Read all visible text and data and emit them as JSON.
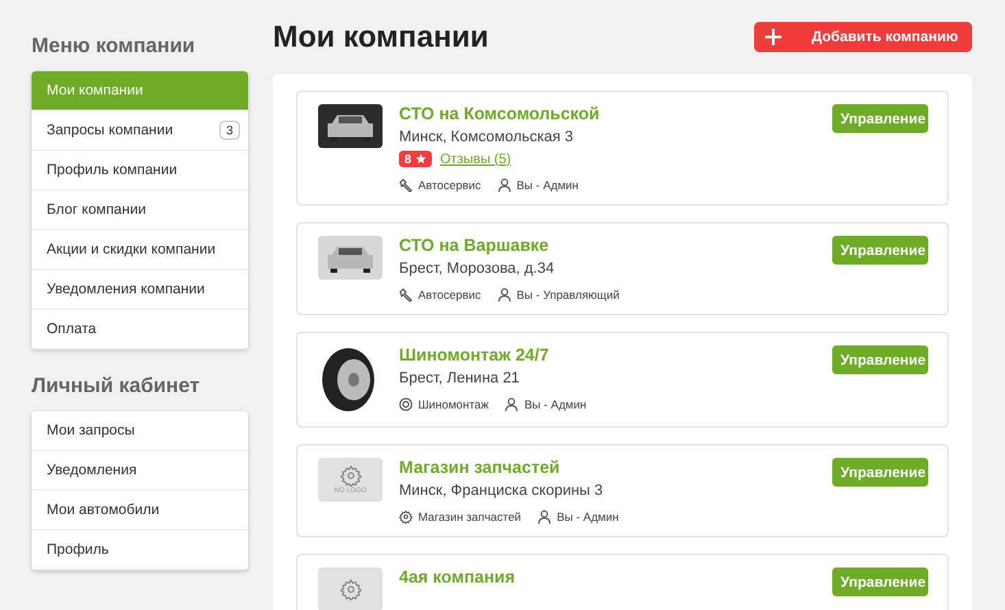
{
  "sidebar": {
    "sections": [
      {
        "title": "Меню компании",
        "items": [
          {
            "label": "Мои компании",
            "selected": true
          },
          {
            "label": "Запросы компании",
            "selected": false,
            "count": "3"
          },
          {
            "label": "Профиль компании",
            "selected": false
          },
          {
            "label": "Блог компании",
            "selected": false
          },
          {
            "label": "Акции и скидки компании",
            "selected": false
          },
          {
            "label": "Уведомления компании",
            "selected": false
          },
          {
            "label": "Оплата",
            "selected": false
          }
        ]
      },
      {
        "title": "Личный кабинет",
        "items": [
          {
            "label": "Мои запросы",
            "selected": false
          },
          {
            "label": "Уведомления",
            "selected": false
          },
          {
            "label": "Мои автомобили",
            "selected": false
          },
          {
            "label": "Профиль",
            "selected": false
          }
        ]
      }
    ]
  },
  "page_title": "Мои компании",
  "add_button": {
    "label": "Добавить компанию"
  },
  "companies": [
    {
      "name": "СТО на Комсомольской",
      "address": "Минск, Комсомольская 3",
      "logo": {
        "kind": "car"
      },
      "rating": "8",
      "reviews": "Отзывы (5)",
      "category": {
        "kind": "wrench",
        "label": "Автосервис"
      },
      "role": "Вы - Админ",
      "button": "Управление"
    },
    {
      "name": "СТО на Варшавке",
      "address": "Брест, Морозова, д.34",
      "logo": {
        "kind": "car"
      },
      "category": {
        "kind": "wrench",
        "label": "Автосервис"
      },
      "role": "Вы - Управляющий",
      "button": "Управление"
    },
    {
      "name": "Шиномонтаж 24/7",
      "address": "Брест, Ленина 21",
      "logo": {
        "kind": "tire"
      },
      "category": {
        "kind": "tire",
        "label": "Шиномонтаж"
      },
      "role": "Вы - Админ",
      "button": "Управление"
    },
    {
      "name": "Магазин запчастей",
      "address": "Минск, Франциска скорины 3",
      "logo": {
        "kind": "nologo",
        "text": "NO LOGO"
      },
      "category": {
        "kind": "gear",
        "label": "Магазин запчастей"
      },
      "role": "Вы - Админ",
      "button": "Управление"
    },
    {
      "name": "4ая компания",
      "logo": {
        "kind": "nologo"
      },
      "button": "Управление"
    }
  ]
}
